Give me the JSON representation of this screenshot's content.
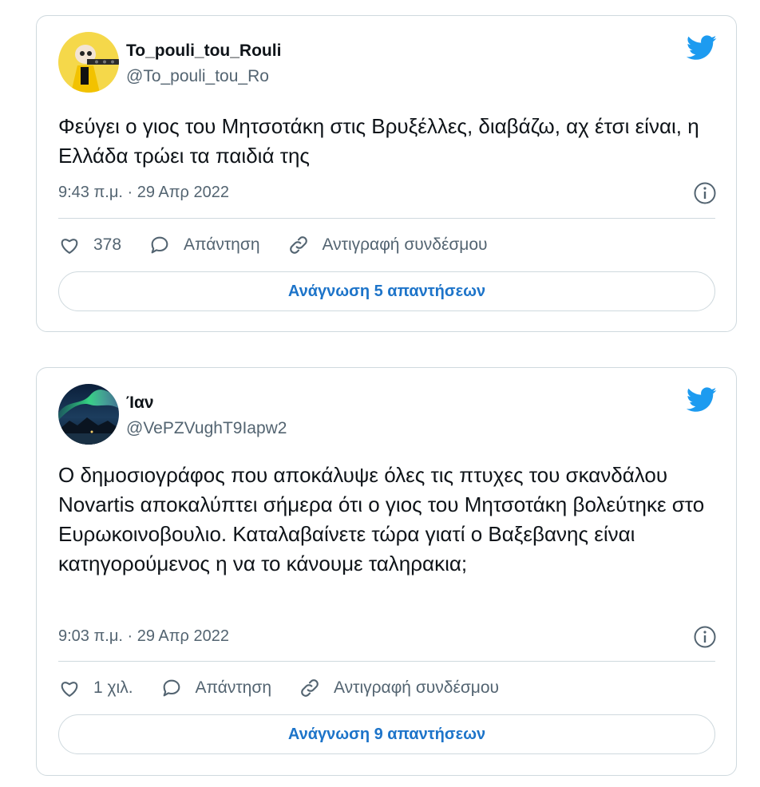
{
  "tweets": [
    {
      "name": "To_pouli_tou_Rouli",
      "handle": "@To_pouli_tou_Ro",
      "text": "Φεύγει ο γιος του Μητσοτάκη στις Βρυξέλλες, διαβάζω, αχ έτσι είναι, η Ελλάδα τρώει τα παιδιά της",
      "timestamp": "9:43 π.μ. · 29 Απρ 2022",
      "likes": "378",
      "reply_label": "Απάντηση",
      "copy_link_label": "Αντιγραφή συνδέσμου",
      "read_replies_label": "Ανάγνωση 5 απαντήσεων"
    },
    {
      "name": "Ίαν",
      "handle": "@VePZVughT9Iapw2",
      "text": "Ο δημοσιογράφος που αποκάλυψε όλες τις πτυχες του σκανδάλου Novartis αποκαλύπτει σήμερα ότι ο γιος του Μητσοτάκη βολεύτηκε στο Ευρωκοινοβουλιο. Καταλαβαίνετε τώρα γιατί ο Βαξεβανης είναι κατηγορούμενος η να το κάνουμε ταληρακια;",
      "timestamp": "9:03 π.μ. · 29 Απρ 2022",
      "likes": "1 χιλ.",
      "reply_label": "Απάντηση",
      "copy_link_label": "Αντιγραφή συνδέσμου",
      "read_replies_label": "Ανάγνωση 9 απαντήσεων"
    }
  ],
  "colors": {
    "twitter_blue": "#1d9bf0",
    "link_blue": "#1d74c9",
    "secondary_text": "#536471",
    "border": "#cfd9de"
  },
  "icons": [
    "twitter-bird-icon",
    "info-icon",
    "heart-icon",
    "reply-icon",
    "link-icon"
  ]
}
